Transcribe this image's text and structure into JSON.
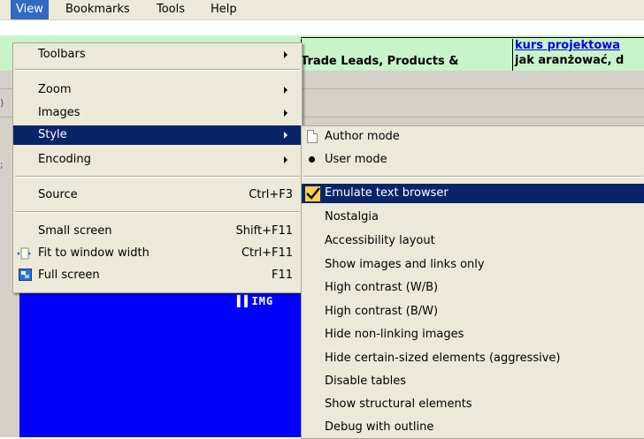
{
  "menubar": {
    "items": [
      {
        "label": "View",
        "active": true
      },
      {
        "label": "Bookmarks",
        "active": false
      },
      {
        "label": "Tools",
        "active": false
      },
      {
        "label": "Help",
        "active": false
      }
    ]
  },
  "page": {
    "cell1_text": "Trade Leads, Products &",
    "cell2_link": "kurs projektowa",
    "cell2_sub": "jak aranżować, d",
    "image_label": "IMG"
  },
  "view_menu": {
    "toolbars": "Toolbars",
    "zoom": "Zoom",
    "images": "Images",
    "style": "Style",
    "encoding": "Encoding",
    "source": "Source",
    "source_shortcut": "Ctrl+F3",
    "small_screen": "Small screen",
    "small_screen_shortcut": "Shift+F11",
    "fit_to_window": "Fit to window width",
    "fit_to_window_shortcut": "Ctrl+F11",
    "full_screen": "Full screen",
    "full_screen_shortcut": "F11"
  },
  "style_menu": {
    "author_mode": "Author mode",
    "user_mode": "User mode",
    "emulate_text_browser": "Emulate text browser",
    "nostalgia": "Nostalgia",
    "accessibility_layout": "Accessibility layout",
    "show_images_links": "Show images and links only",
    "high_contrast_wb": "High contrast (W/B)",
    "high_contrast_bw": "High contrast (B/W)",
    "hide_nonlinking": "Hide non-linking images",
    "hide_certain_sized": "Hide certain-sized elements (aggressive)",
    "disable_tables": "Disable tables",
    "show_structural": "Show structural elements",
    "debug_outline": "Debug with outline"
  },
  "colors": {
    "menu_bg": "#ece9d8",
    "highlight": "#0a246a",
    "menubar_active": "#316ac5",
    "page_green": "#c9f3c9",
    "panel_blue": "#0000ff",
    "link": "#0000ee"
  }
}
